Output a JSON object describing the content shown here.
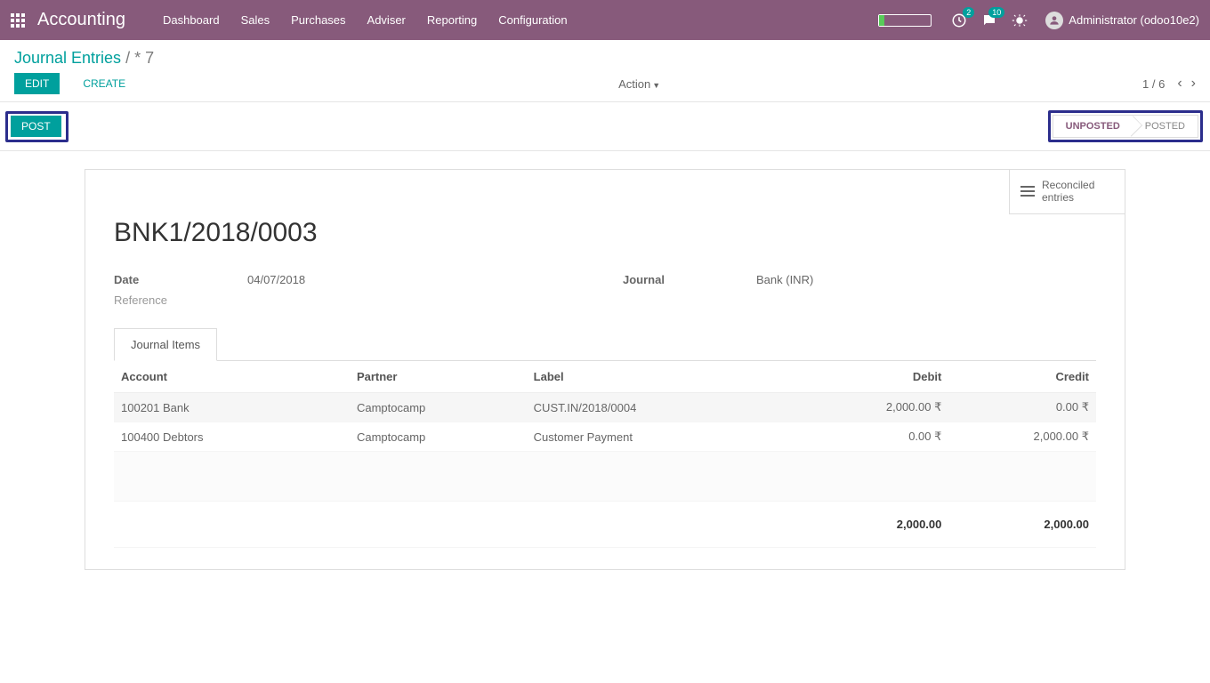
{
  "navbar": {
    "brand": "Accounting",
    "links": [
      "Dashboard",
      "Sales",
      "Purchases",
      "Adviser",
      "Reporting",
      "Configuration"
    ],
    "messages_badge": "2",
    "activities_badge": "10",
    "user": "Administrator (odoo10e2)"
  },
  "control_panel": {
    "breadcrumb_root": "Journal Entries",
    "breadcrumb_current": "* 7",
    "edit": "Edit",
    "create": "Create",
    "action": "Action",
    "pager": "1 / 6"
  },
  "statusbar": {
    "post": "Post",
    "unposted": "Unposted",
    "posted": "Posted"
  },
  "sheet": {
    "reconciled_label": "Reconciled entries",
    "title": "BNK1/2018/0003",
    "date_label": "Date",
    "date_value": "04/07/2018",
    "reference_label": "Reference",
    "journal_label": "Journal",
    "journal_value": "Bank (INR)",
    "tab_label": "Journal Items",
    "columns": {
      "account": "Account",
      "partner": "Partner",
      "label": "Label",
      "debit": "Debit",
      "credit": "Credit"
    },
    "rows": [
      {
        "account": "100201 Bank",
        "partner": "Camptocamp",
        "label": "CUST.IN/2018/0004",
        "debit": "2,000.00 ₹",
        "credit": "0.00 ₹"
      },
      {
        "account": "100400 Debtors",
        "partner": "Camptocamp",
        "label": "Customer Payment",
        "debit": "0.00 ₹",
        "credit": "2,000.00 ₹"
      }
    ],
    "total_debit": "2,000.00",
    "total_credit": "2,000.00"
  }
}
